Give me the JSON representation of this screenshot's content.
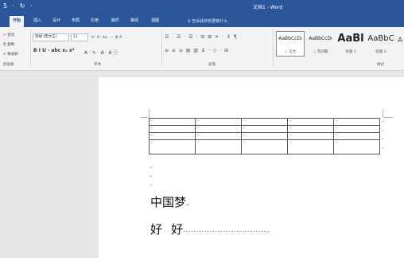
{
  "app": {
    "quick_access": "5 · ↻ ·",
    "title": "文档1 - Word"
  },
  "tabs": [
    {
      "label": "开始",
      "active": true
    },
    {
      "label": "插入"
    },
    {
      "label": "设计"
    },
    {
      "label": "布局"
    },
    {
      "label": "引用"
    },
    {
      "label": "邮件"
    },
    {
      "label": "审阅"
    },
    {
      "label": "视图"
    }
  ],
  "tell_me": "♀ 告诉我你想要做什么",
  "clipboard": {
    "cut": "✂ 剪切",
    "copy": "⎘ 复制",
    "painter": "✔ 格式刷",
    "label": "剪贴板"
  },
  "font": {
    "name": "等线 (西文正)",
    "size": "11",
    "grow_shrink": "A⁺ A⁻  Aa ·  ♢ 文 A",
    "format_row": "B  I  U ·  abc  x₂  x²",
    "color_row": "A ·  ✎ ·  A ·  A  ㊀",
    "label": "字体"
  },
  "paragraph": {
    "row1": "☰ · ☰ · ☰ ·  ⊟ ⊞   ✕ ·  ↕  ¶",
    "row2": "≡ ≡ ≡ ▤ ▥   ↨ ·   ◇ · ⊞ ·",
    "label": "段落"
  },
  "styles": {
    "items": [
      {
        "preview": "AaBbCcDı",
        "name": "⊥ 正文",
        "selected": true
      },
      {
        "preview": "AaBbCcDı",
        "name": "⊥ 无间隔"
      },
      {
        "preview": "AaBl",
        "name": "标题 1"
      },
      {
        "preview": "AaBbC",
        "name": "标题 2"
      }
    ],
    "more": "A",
    "label": "样式"
  },
  "document": {
    "table_rows": 4,
    "table_cols": 5,
    "cell_mark": "↵",
    "heading": "中国梦",
    "line2_left": "好",
    "line2_right": "好",
    "para_mark": "↵"
  }
}
